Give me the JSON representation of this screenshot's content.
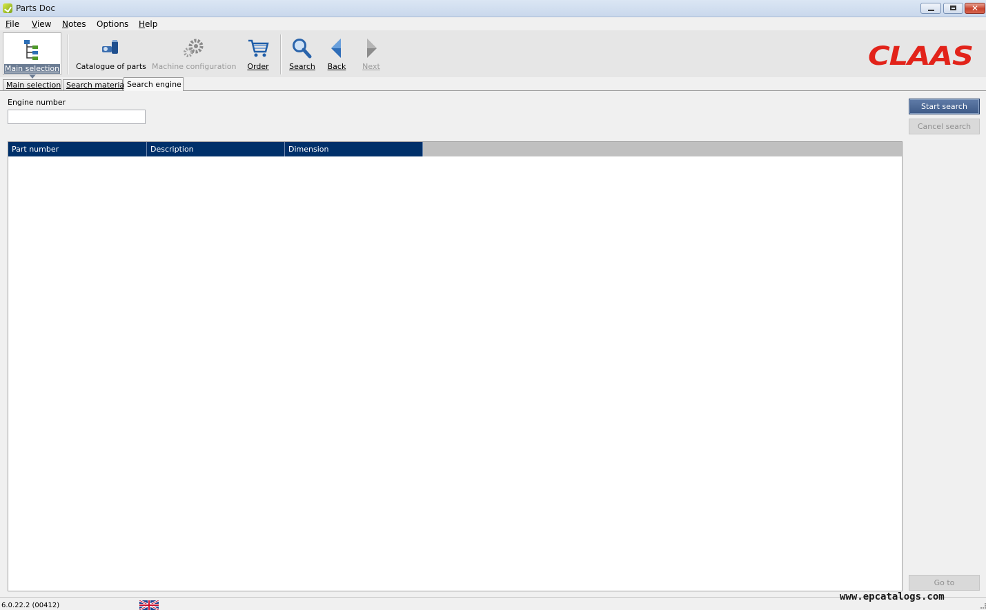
{
  "window": {
    "title": "Parts Doc"
  },
  "menu": [
    {
      "key": "F",
      "rest": "ile"
    },
    {
      "key": "V",
      "rest": "iew"
    },
    {
      "key": "N",
      "rest": "otes"
    },
    {
      "key": "",
      "rest": "Options"
    },
    {
      "key": "H",
      "rest": "elp"
    }
  ],
  "toolbar": {
    "main_selection": "Main selection",
    "catalogue": "Catalogue of parts",
    "machine_config": "Machine configuration",
    "order": "Order",
    "search": "Search",
    "back": "Back",
    "next": "Next"
  },
  "brand": {
    "logo": "CLAAS",
    "color": "#e2231a"
  },
  "tabs": [
    {
      "label": "Main selection",
      "active": false
    },
    {
      "label": "Search material",
      "active": false
    },
    {
      "label": "Search engine",
      "active": true
    }
  ],
  "form": {
    "engine_label": "Engine number",
    "engine_value": ""
  },
  "table": {
    "columns": [
      "Part number",
      "Description",
      "Dimension"
    ],
    "rows": []
  },
  "buttons": {
    "start_search": "Start search",
    "cancel_search": "Cancel search",
    "goto": "Go to"
  },
  "status": {
    "version": "6.0.22.2 (00412)",
    "watermark": "www.epcatalogs.com"
  },
  "colors": {
    "header_bg": "#00306a",
    "accent": "#3e5a87"
  }
}
